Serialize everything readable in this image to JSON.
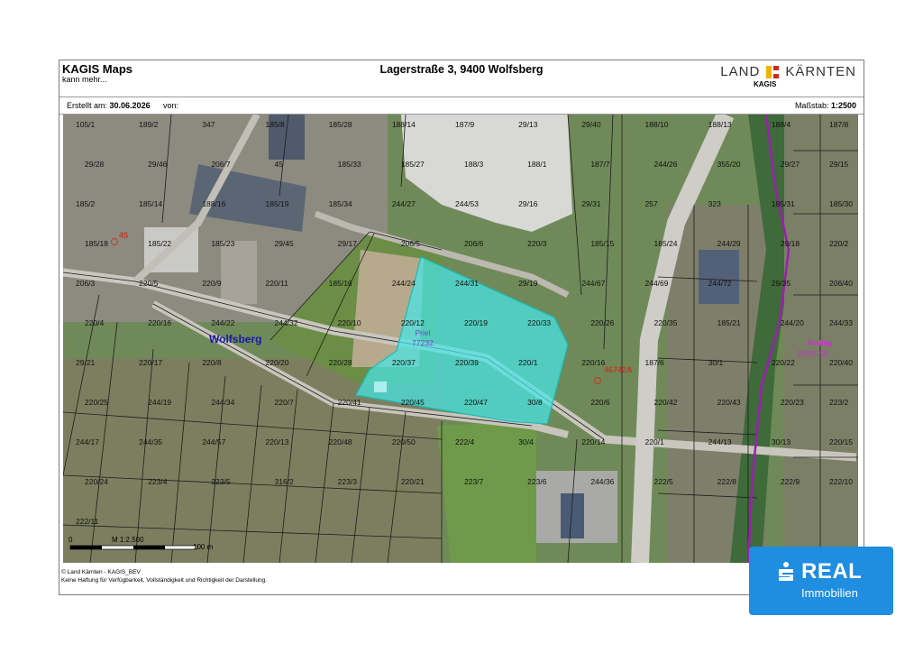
{
  "header": {
    "app_title": "KAGIS Maps",
    "app_subtitle": "kann mehr...",
    "address": "Lagerstraße 3, 9400 Wolfsberg",
    "brand_left": "LAND",
    "brand_right": "KÄRNTEN",
    "brand_sub": "KAGIS"
  },
  "meta": {
    "created_label": "Erstellt am:",
    "created_date": "30.06.2026",
    "by_label": "von:",
    "scale_label": "Maßstab:",
    "scale_value": "1:2500"
  },
  "map": {
    "place_label": "Wolfsberg",
    "parcel_highlight": {
      "line1": "Priel",
      "line2": "77232"
    },
    "route_labels": [
      "46742A",
      "45"
    ],
    "other_place": "Reding",
    "other_place_code": "29/23 231",
    "parcel_labels": [
      "105/1",
      "189/2",
      "347",
      "185/8",
      "185/28",
      "188/14",
      "187/9",
      "29/13",
      "29/40",
      "188/10",
      "188/13",
      "188/4",
      "187/8",
      "29/28",
      "29/46",
      "206/7",
      "45",
      "185/33",
      "185/27",
      "188/3",
      "188/1",
      "187/7",
      "244/26",
      "355/20",
      "29/27",
      "29/15",
      "185/2",
      "185/14",
      "188/16",
      "185/19",
      "185/34",
      "244/27",
      "244/53",
      "29/16",
      "29/31",
      "257",
      "323",
      "185/31",
      "185/30",
      "185/18",
      "185/22",
      "185/23",
      "29/45",
      "29/17",
      "206/5",
      "206/6",
      "220/3",
      "185/15",
      "185/24",
      "244/29",
      "29/18",
      "220/2",
      "206/3",
      "220/5",
      "220/9",
      "220/11",
      "185/16",
      "244/24",
      "244/31",
      "29/19",
      "244/67",
      "244/69",
      "244/72",
      "29/35",
      "206/40",
      "220/4",
      "220/16",
      "244/22",
      "244/32",
      "220/10",
      "220/12",
      "220/19",
      "220/33",
      "220/26",
      "220/35",
      "185/21",
      "244/20",
      "244/33",
      "29/21",
      "220/17",
      "220/8",
      "220/20",
      "220/28",
      "220/37",
      "220/39",
      "220/1",
      "220/16",
      "187/6",
      "30/1",
      "220/22",
      "220/40",
      "220/25",
      "244/19",
      "244/34",
      "220/7",
      "220/41",
      "220/45",
      "220/47",
      "30/8",
      "220/6",
      "220/42",
      "220/43",
      "220/23",
      "223/2",
      "244/17",
      "244/35",
      "244/57",
      "220/13",
      "220/48",
      "220/50",
      "222/4",
      "30/4",
      "220/14",
      "220/1",
      "244/13",
      "30/13",
      "220/15",
      "220/24",
      "223/4",
      "223/5",
      "316/2",
      "223/3",
      "220/21",
      "223/7",
      "223/6",
      "244/36",
      "222/5",
      "222/8",
      "222/9",
      "222/10",
      "222/11"
    ],
    "scale_bar": {
      "start": "0",
      "mid": "M 1:2.500",
      "end": "100 m"
    }
  },
  "footer": {
    "line1": "© Land Kärnten - KAGIS_BEV",
    "line2": "Keine Haftung für Verfügbarkeit, Vollständigkeit und Richtigkeit der Darstellung."
  },
  "badge": {
    "brand": "REAL",
    "sub": "Immobilien",
    "color": "#1f8de0"
  },
  "colors": {
    "highlight_fill": "#46e6e6",
    "route_color": "#c0392b",
    "boundary_color": "#9b1fb0",
    "place_label_color": "#1a1aa8"
  }
}
